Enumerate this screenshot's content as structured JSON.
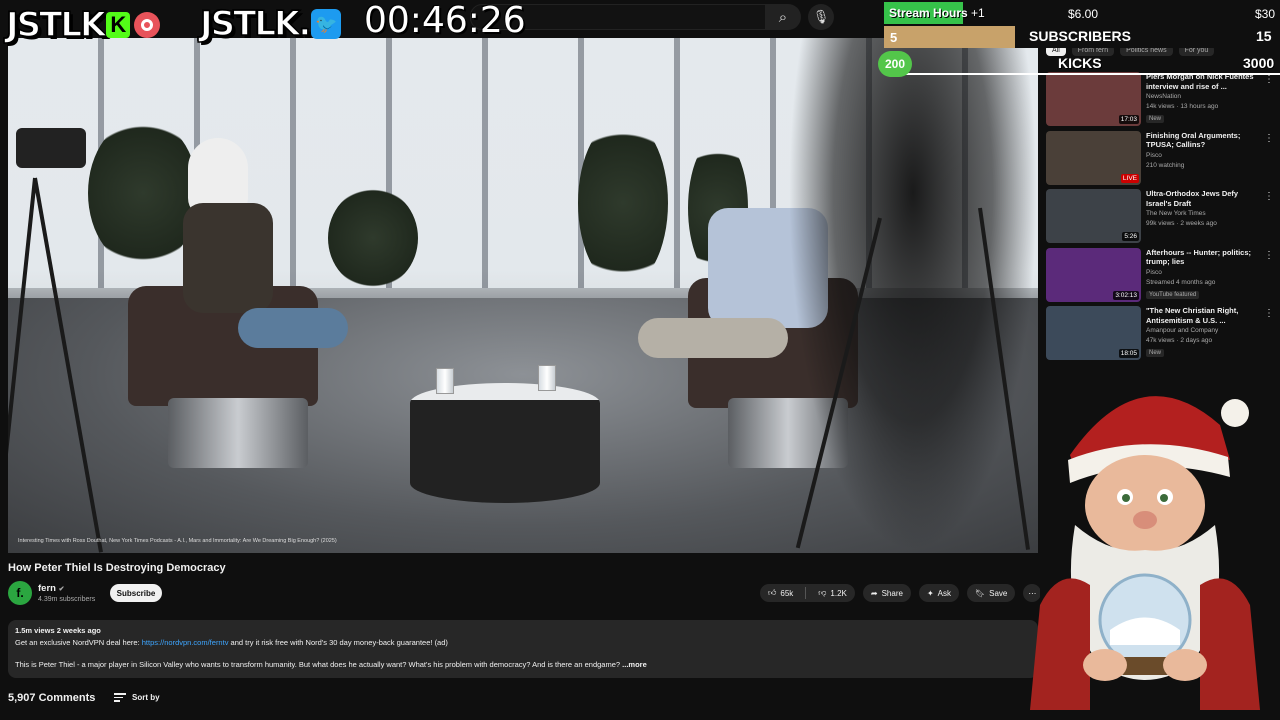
{
  "overlay": {
    "logo_left": "JSTLK",
    "kick_letter": "K",
    "logo_right": "JSTLK.",
    "timer": "00:46:26",
    "stream_hours": {
      "label": "Stream Hours",
      "increment": "+1",
      "price_mid": "$6.00",
      "price_right": "$30",
      "fill_fraction": 0.2
    },
    "subscribers": {
      "current": "5",
      "label": "SUBSCRIBERS",
      "goal": "15",
      "fill_fraction": 0.33
    },
    "kicks": {
      "current": "200",
      "label": "KICKS",
      "goal": "3000"
    }
  },
  "topbar": {
    "search_icon": "search-icon",
    "mic_icon": "mic-icon"
  },
  "video": {
    "caption": "Interesting Times with Ross Douthat, New York Times Podcasts - A.I., Mars and Immortality: Are We Dreaming Big Enough? (2025)"
  },
  "info": {
    "title": "How Peter Thiel Is Destroying Democracy",
    "channel_initial": "f.",
    "channel_name": "fern",
    "subscribers": "4.39m subscribers",
    "subscribe_label": "Subscribe",
    "likes": "65k",
    "dislikes": "1.2K",
    "share_label": "Share",
    "ask_label": "Ask",
    "save_label": "Save"
  },
  "description": {
    "meta": "1.5m views  2 weeks ago",
    "line1_pre": "Get an exclusive NordVPN deal here: ",
    "line1_link": "https://nordvpn.com/ferntv",
    "line1_post": " and try it risk free with Nord's 30 day money-back guarantee! (ad)",
    "line2": "This is Peter Thiel - a major player in Silicon Valley who wants to transform humanity. But what does he actually want? What's his problem with democracy? And is there an endgame?",
    "more_label": "...more"
  },
  "comments": {
    "count": "5,907 Comments",
    "sort_label": "Sort by"
  },
  "sidebar": {
    "chips": [
      "All",
      "From fern",
      "Politics news",
      "For you"
    ],
    "items": [
      {
        "title": "Piers Morgan on Nick Fuentes interview and rise of ...",
        "channel": "NewsNation",
        "meta": "14k views · 13 hours ago",
        "badge": "New",
        "duration": "17:03",
        "thumb": "#6b3b3b"
      },
      {
        "title": "Finishing Oral Arguments; TPUSA; Callins?",
        "channel": "Pisco",
        "meta": "210 watching",
        "badge": "",
        "duration": "LIVE",
        "thumb": "#4a4038"
      },
      {
        "title": "Ultra-Orthodox Jews Defy Israel's Draft",
        "channel": "The New York Times",
        "meta": "99k views · 2 weeks ago",
        "badge": "",
        "duration": "5:26",
        "thumb": "#3d4248"
      },
      {
        "title": "Afterhours -- Hunter; politics; trump; lies",
        "channel": "Pisco",
        "meta": "Streamed 4 months ago",
        "badge": "YouTube featured",
        "duration": "3:02:13",
        "thumb": "#5b2a7a"
      },
      {
        "title": "\"The New Christian Right, Antisemitism & U.S. ...",
        "channel": "Amanpour and Company",
        "meta": "47k views · 2 days ago",
        "badge": "New",
        "duration": "18:05",
        "thumb": "#3c4a5a"
      }
    ]
  }
}
